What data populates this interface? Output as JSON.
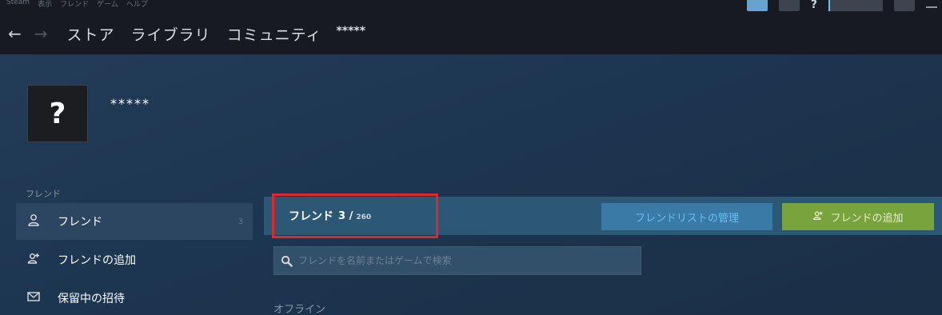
{
  "titlebar": {
    "menu": [
      "Steam",
      "表示",
      "フレンド",
      "ゲーム",
      "ヘルプ"
    ],
    "help_glyph": "?"
  },
  "nav": {
    "back_glyph": "←",
    "forward_glyph": "→",
    "links": [
      "ストア",
      "ライブラリ",
      "コミュニティ"
    ],
    "username": "*****"
  },
  "profile": {
    "avatar_glyph": "?",
    "name": "*****"
  },
  "sidebar": {
    "header": "フレンド",
    "items": [
      {
        "icon": "person-icon",
        "label": "フレンド",
        "count": "3"
      },
      {
        "icon": "add-person-icon",
        "label": "フレンドの追加"
      },
      {
        "icon": "envelope-icon",
        "label": "保留中の招待"
      }
    ]
  },
  "content": {
    "count_label": "フレンド",
    "count_value": "3 /",
    "count_total": "260",
    "manage_button": "フレンドリストの管理",
    "add_button": "フレンドの追加",
    "search_placeholder": "フレンドを名前またはゲームで検索",
    "section_offline": "オフライン"
  },
  "colors": {
    "accent": "#66c0f4",
    "add_button": "#79a33d",
    "highlight_border": "#e2272b"
  }
}
